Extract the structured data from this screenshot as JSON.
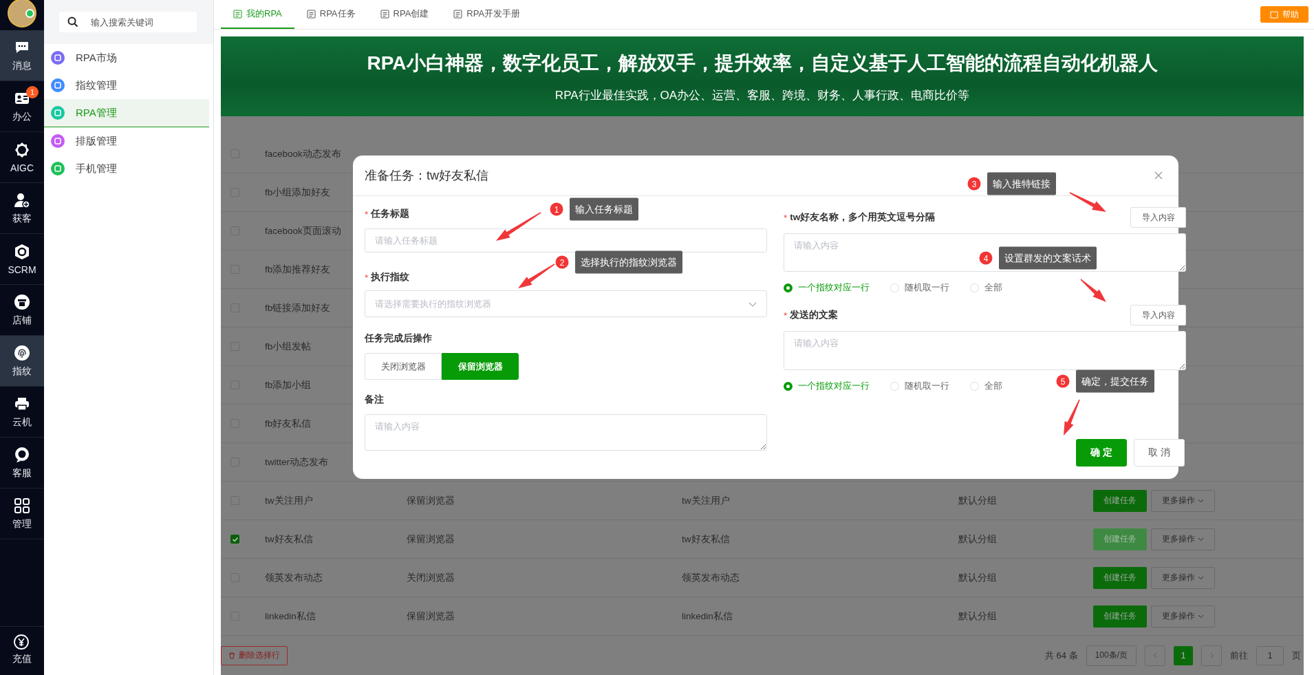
{
  "rail": {
    "items": [
      {
        "label": "消息",
        "selected": true
      },
      {
        "label": "办公",
        "selected": false,
        "badge": "1"
      },
      {
        "label": "AIGC",
        "selected": false
      },
      {
        "label": "获客",
        "selected": false
      },
      {
        "label": "SCRM",
        "selected": false
      },
      {
        "label": "店铺",
        "selected": false
      },
      {
        "label": "指纹",
        "selected": true
      },
      {
        "label": "云机",
        "selected": false
      },
      {
        "label": "客服",
        "selected": false
      },
      {
        "label": "管理",
        "selected": false
      }
    ],
    "bottom_item": "充值"
  },
  "sidebar": {
    "search_placeholder": "输入搜索关键词",
    "items": [
      {
        "label": "RPA市场",
        "selected": false,
        "color": "#7b6cf6"
      },
      {
        "label": "指纹管理",
        "selected": false,
        "color": "#3f8cff"
      },
      {
        "label": "RPA管理",
        "selected": true,
        "color": "#17c9a0"
      },
      {
        "label": "排版管理",
        "selected": false,
        "color": "#c45cf2"
      },
      {
        "label": "手机管理",
        "selected": false,
        "color": "#1ec15a"
      }
    ]
  },
  "tabs": [
    {
      "label": "我的RPA",
      "selected": true
    },
    {
      "label": "RPA任务",
      "selected": false
    },
    {
      "label": "RPA创建",
      "selected": false
    },
    {
      "label": "RPA开发手册",
      "selected": false
    }
  ],
  "help_button": "帮助",
  "banner": {
    "title": "RPA小白神器，数字化员工，解放双手，提升效率，自定义基于人工智能的流程自动化机器人",
    "subtitle": "RPA行业最佳实践，OA办公、运营、客服、跨境、财务、人事行政、电商比价等"
  },
  "table": {
    "rows": [
      {
        "checked": false,
        "cells": [
          "facebook动态发布"
        ]
      },
      {
        "checked": false,
        "cells": [
          "fb小组添加好友"
        ]
      },
      {
        "checked": false,
        "cells": [
          "facebook页面滚动"
        ]
      },
      {
        "checked": false,
        "cells": [
          "fb添加推荐好友"
        ]
      },
      {
        "checked": false,
        "cells": [
          "fb链接添加好友"
        ]
      },
      {
        "checked": false,
        "cells": [
          "fb小组发帖"
        ]
      },
      {
        "checked": false,
        "cells": [
          "fb添加小组"
        ]
      },
      {
        "checked": false,
        "cells": [
          "fb好友私信"
        ]
      },
      {
        "checked": false,
        "cells": [
          "twitter动态发布"
        ]
      },
      {
        "checked": false,
        "cells": [
          "tw关注用户",
          "保留浏览器",
          "tw关注用户",
          "默认分组"
        ],
        "actions": [
          "创建任务",
          "更多操作"
        ]
      },
      {
        "checked": true,
        "cells": [
          "tw好友私信",
          "保留浏览器",
          "tw好友私信",
          "默认分组"
        ],
        "actions": [
          "创建任务",
          "更多操作"
        ]
      },
      {
        "checked": false,
        "cells": [
          "领英发布动态",
          "关闭浏览器",
          "领英发布动态",
          "默认分组"
        ],
        "actions": [
          "创建任务",
          "更多操作"
        ]
      },
      {
        "checked": false,
        "cells": [
          "linkedin私信",
          "保留浏览器",
          "linkedin私信",
          "默认分组"
        ],
        "actions": [
          "创建任务",
          "更多操作"
        ]
      }
    ]
  },
  "footer": {
    "delete_button": "删除选择行",
    "total": "共 64 条",
    "page_size": "100条/页",
    "pages": [
      {
        "label": "1",
        "selected": true
      }
    ],
    "goto_label": "前往",
    "goto_value": "1",
    "page_unit": "页"
  },
  "modal": {
    "title": "准备任务：tw好友私信",
    "left_fields": [
      {
        "kind": "input",
        "required_mark": "*",
        "label": "任务标题",
        "placeholder": "请输入任务标题"
      },
      {
        "kind": "select",
        "required_mark": "*",
        "label": "执行指纹",
        "placeholder": "请选择需要执行的指纹浏览器"
      },
      {
        "kind": "segmented",
        "label": "任务完成后操作",
        "options": [
          {
            "label": "关闭浏览器",
            "selected": false
          },
          {
            "label": "保留浏览器",
            "selected": true
          }
        ]
      },
      {
        "kind": "textarea",
        "label": "备注",
        "placeholder": "请输入内容"
      }
    ],
    "right_fields": [
      {
        "kind": "textarea",
        "required_mark": "*",
        "label": "tw好友名称，多个用英文逗号分隔",
        "placeholder": "请输入内容",
        "import_button": "导入内容",
        "options": [
          {
            "label": "一个指纹对应一行",
            "selected": true
          },
          {
            "label": "随机取一行",
            "selected": false
          },
          {
            "label": "全部",
            "selected": false
          }
        ]
      },
      {
        "kind": "textarea",
        "required_mark": "*",
        "label": "发送的文案",
        "placeholder": "请输入内容",
        "import_button": "导入内容",
        "options": [
          {
            "label": "一个指纹对应一行",
            "selected": true
          },
          {
            "label": "随机取一行",
            "selected": false
          },
          {
            "label": "全部",
            "selected": false
          }
        ]
      }
    ],
    "buttons": [
      {
        "label": "确 定",
        "kind": "primary"
      },
      {
        "label": "取 消",
        "kind": "default"
      }
    ],
    "callouts": [
      {
        "number": "1",
        "text": "输入任务标题"
      },
      {
        "number": "2",
        "text": "选择执行的指纹浏览器"
      },
      {
        "number": "3",
        "text": "输入推特链接"
      },
      {
        "number": "4",
        "text": "设置群发的文案话术"
      },
      {
        "number": "5",
        "text": "确定，提交任务"
      }
    ]
  }
}
